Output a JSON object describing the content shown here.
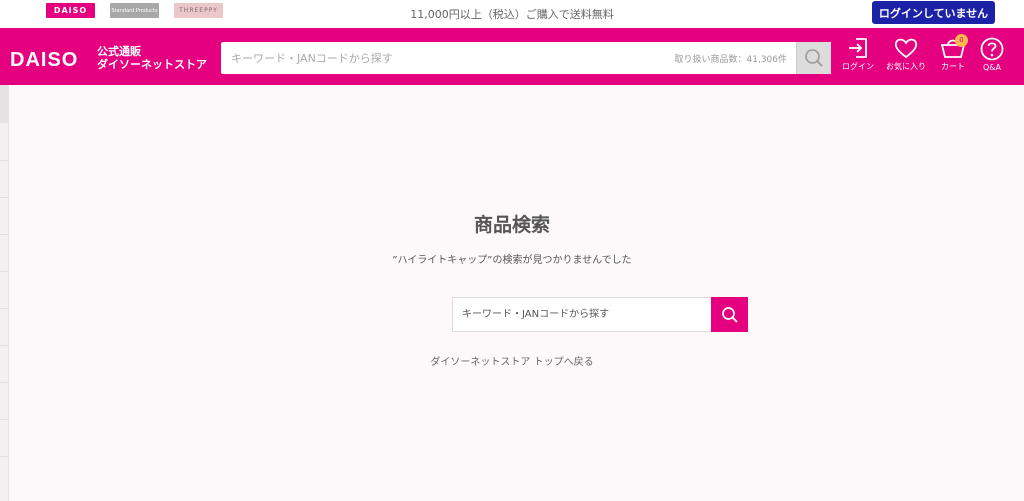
{
  "topbar": {
    "brands": [
      "DAISO",
      "Standard Products",
      "THREEPPY"
    ],
    "shipping_notice": "11,000円以上（税込）ご購入で送料無料",
    "login_label": "ログインしていません"
  },
  "header": {
    "logo_text": "DAISO",
    "logo_sub_line1": "公式通販",
    "logo_sub_line2": "ダイソーネットストア",
    "search_placeholder": "キーワード・JANコードから探す",
    "item_count": "取り扱い商品数：41,306件",
    "icons": {
      "login": "ログイン",
      "favorites": "お気に入り",
      "cart": "カート",
      "cart_count": "0",
      "qa": "Q&A"
    }
  },
  "main": {
    "title": "商品検索",
    "not_found_message": "”ハイライトキャップ”の検索が見つかりませんでした",
    "search_placeholder": "キーワード・JANコードから探す",
    "back_link": "ダイソーネットストア トップへ戻る"
  },
  "colors": {
    "brand_pink": "#e4007f",
    "login_blue": "#1c22a8"
  }
}
